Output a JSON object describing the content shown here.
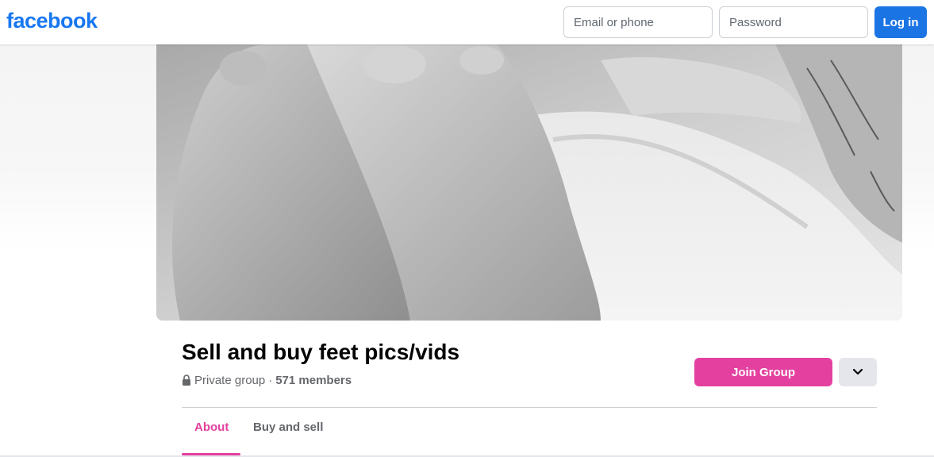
{
  "header": {
    "logo": "facebook",
    "email_placeholder": "Email or phone",
    "password_placeholder": "Password",
    "login_label": "Log in"
  },
  "cover": {
    "description_icon": "cover-photo"
  },
  "group": {
    "title": "Sell and buy feet pics/vids",
    "privacy": "Private group",
    "separator": "·",
    "members": "571 members",
    "join_label": "Join Group"
  },
  "tabs": [
    {
      "label": "About",
      "active": true
    },
    {
      "label": "Buy and sell",
      "active": false
    }
  ],
  "colors": {
    "brand": "#1877f2",
    "login_button": "#1b74e4",
    "group_accent": "#e4409f",
    "secondary_button": "#e4e6eb",
    "muted_text": "#65676b"
  },
  "icons": {
    "privacy": "lock-icon",
    "more": "chevron-down-icon"
  }
}
